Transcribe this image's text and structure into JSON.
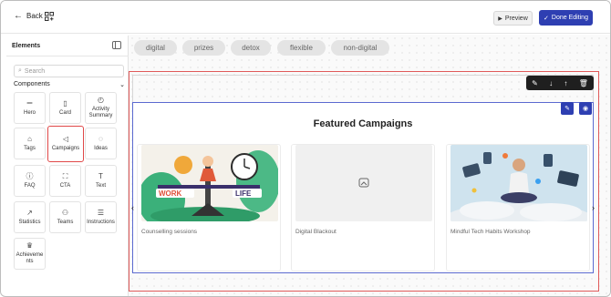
{
  "topbar": {
    "back_label": "Back",
    "preview_label": "Preview",
    "done_label": "Done Editing"
  },
  "sidebar": {
    "title": "Elements",
    "search_placeholder": "Search",
    "section_label": "Components",
    "tiles": [
      {
        "label": "Hero",
        "icon": "equals-icon"
      },
      {
        "label": "Card",
        "icon": "card-icon"
      },
      {
        "label": "Activity Summary",
        "icon": "activity-icon"
      },
      {
        "label": "Tags",
        "icon": "tag-icon"
      },
      {
        "label": "Campaigns",
        "icon": "megaphone-icon"
      },
      {
        "label": "Ideas",
        "icon": "lightbulb-icon"
      },
      {
        "label": "FAQ",
        "icon": "question-icon"
      },
      {
        "label": "CTA",
        "icon": "cta-icon"
      },
      {
        "label": "Text",
        "icon": "text-icon"
      },
      {
        "label": "Statistics",
        "icon": "trend-icon"
      },
      {
        "label": "Teams",
        "icon": "people-icon"
      },
      {
        "label": "Instructions",
        "icon": "instructions-icon"
      },
      {
        "label": "Achievements",
        "icon": "trophy-icon"
      }
    ]
  },
  "tags": [
    "digital",
    "prizes",
    "detox",
    "flexible",
    "non-digital"
  ],
  "section": {
    "title": "Featured Campaigns",
    "cards": [
      {
        "caption": "Counselling sessions",
        "image": "work-life-balance"
      },
      {
        "caption": "Digital Blackout",
        "image": "placeholder"
      },
      {
        "caption": "Mindful Tech Habits Workshop",
        "image": "meditation"
      }
    ]
  },
  "colors": {
    "accent": "#2e3fb2",
    "selection_red": "#e05a5a",
    "selection_blue": "#5b6ad0"
  }
}
